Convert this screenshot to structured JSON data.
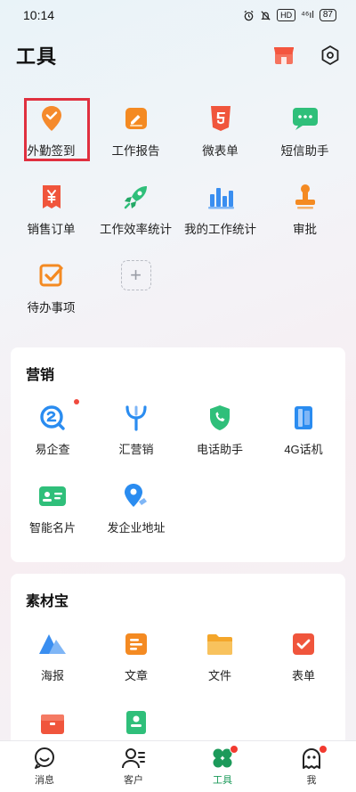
{
  "status_bar": {
    "time": "10:14",
    "hd": "HD",
    "signal": "⁴⁶ıl",
    "battery": "87"
  },
  "header": {
    "title": "工具"
  },
  "tools": [
    {
      "label": "外勤签到",
      "icon": "location-check-icon",
      "color": "#f58a2c"
    },
    {
      "label": "工作报告",
      "icon": "report-pen-icon",
      "color": "#f48a22"
    },
    {
      "label": "微表单",
      "icon": "html5-form-icon",
      "color": "#f0553c"
    },
    {
      "label": "短信助手",
      "icon": "sms-bubble-icon",
      "color": "#2fbf7a"
    },
    {
      "label": "销售订单",
      "icon": "yen-order-icon",
      "color": "#f0553c"
    },
    {
      "label": "工作效率统计",
      "icon": "rocket-icon",
      "color": "#2fbf7a"
    },
    {
      "label": "我的工作统计",
      "icon": "bar-chart-icon",
      "color": "#3a8ef0"
    },
    {
      "label": "审批",
      "icon": "stamp-icon",
      "color": "#f48a22"
    },
    {
      "label": "待办事项",
      "icon": "todo-check-icon",
      "color": "#f48a22"
    }
  ],
  "marketing": {
    "title": "营销",
    "items": [
      {
        "label": "易企查",
        "icon": "search-e-icon",
        "color": "#2a8cf0",
        "badge": true
      },
      {
        "label": "汇营销",
        "icon": "fork-marketing-icon",
        "color": "#2a8cf0",
        "badge": false
      },
      {
        "label": "电话助手",
        "icon": "phone-shield-icon",
        "color": "#2fbf7a",
        "badge": false
      },
      {
        "label": "4G话机",
        "icon": "handset-icon",
        "color": "#2a8cf0",
        "badge": false
      },
      {
        "label": "智能名片",
        "icon": "business-card-icon",
        "color": "#2fbf7a",
        "badge": false
      },
      {
        "label": "发企业地址",
        "icon": "map-pin-send-icon",
        "color": "#2a8cf0",
        "badge": false
      }
    ]
  },
  "materials": {
    "title": "素材宝",
    "items": [
      {
        "label": "海报",
        "icon": "poster-icon",
        "color": "#3a8ef0"
      },
      {
        "label": "文章",
        "icon": "article-icon",
        "color": "#f48a22"
      },
      {
        "label": "文件",
        "icon": "folder-icon",
        "color": "#f4a62a"
      },
      {
        "label": "表单",
        "icon": "form-check-icon",
        "color": "#f0553c"
      },
      {
        "label": "",
        "icon": "box-icon",
        "color": "#f0553c"
      },
      {
        "label": "",
        "icon": "contact-doc-icon",
        "color": "#2fbf7a"
      }
    ]
  },
  "tab_bar": {
    "tabs": [
      {
        "label": "消息",
        "icon": "message-icon",
        "badge": false
      },
      {
        "label": "客户",
        "icon": "customer-icon",
        "badge": false
      },
      {
        "label": "工具",
        "icon": "clover-tools-icon",
        "badge": true
      },
      {
        "label": "我",
        "icon": "ghost-me-icon",
        "badge": true
      }
    ],
    "active_color": "#1c9a5a"
  }
}
